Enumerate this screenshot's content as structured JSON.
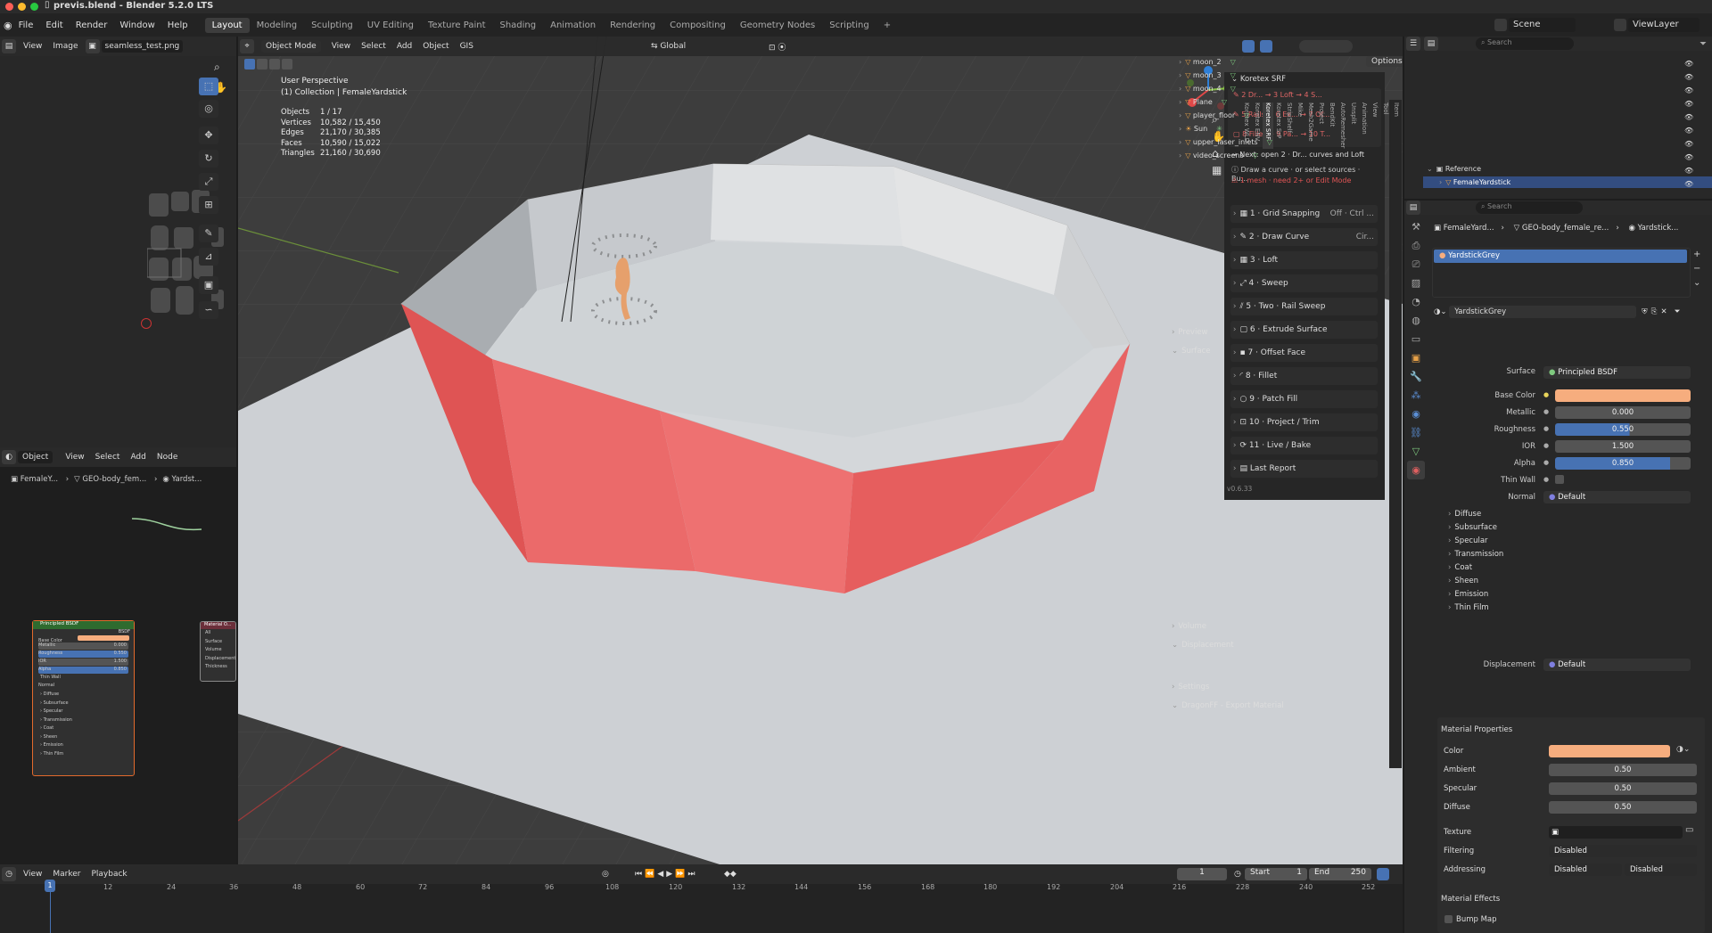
{
  "window": {
    "title": "previs.blend - Blender 5.2.0 LTS"
  },
  "menu": [
    "File",
    "Edit",
    "Render",
    "Window",
    "Help"
  ],
  "workspaces": [
    "Layout",
    "Modeling",
    "Sculpting",
    "UV Editing",
    "Texture Paint",
    "Shading",
    "Animation",
    "Rendering",
    "Compositing",
    "Geometry Nodes",
    "Scripting",
    "+"
  ],
  "scene": {
    "label": "Scene",
    "viewlayer": "ViewLayer"
  },
  "image_editor": {
    "view": "View",
    "image": "Image",
    "filename": "seamless_test.png"
  },
  "node_editor": {
    "mode": "Object",
    "view": "View",
    "select": "Select",
    "add": "Add",
    "node": "Node",
    "crumb1": "FemaleY...",
    "crumb2": "GEO-body_fem...",
    "crumb3": "Yardst...",
    "bsdf_title": "Principled BSDF",
    "bsdf_out": "BSDF",
    "base_color": "Base Color",
    "metallic": "Metallic",
    "metallic_v": "0.000",
    "roughness": "Roughness",
    "roughness_v": "0.550",
    "ior": "IOR",
    "ior_v": "1.500",
    "alpha": "Alpha",
    "alpha_v": "0.850",
    "thinwall": "Thin Wall",
    "normal": "Normal",
    "subs": [
      "Diffuse",
      "Subsurface",
      "Specular",
      "Transmission",
      "Coat",
      "Sheen",
      "Emission",
      "Thin Film"
    ],
    "out_title": "Material O...",
    "out_items": [
      "All",
      "Surface",
      "Volume",
      "Displacement",
      "Thickness"
    ]
  },
  "viewport": {
    "mode": "Object Mode",
    "view": "View",
    "select": "Select",
    "add": "Add",
    "object": "Object",
    "gis": "GIS",
    "orient": "Global",
    "options": "Options",
    "title": "User Perspective",
    "collection": "(1) Collection | FemaleYardstick",
    "stats": [
      [
        "Objects",
        "1 / 17"
      ],
      [
        "Vertices",
        "10,582 / 15,450"
      ],
      [
        "Edges",
        "21,170 / 30,385"
      ],
      [
        "Faces",
        "10,590 / 15,022"
      ],
      [
        "Triangles",
        "21,160 / 30,690"
      ]
    ]
  },
  "koretex": {
    "title": "Koretex SRF",
    "flow": [
      [
        "2 Dr...",
        "3 Loft",
        "4 S..."
      ],
      [
        "5 Rails",
        "6 Ex...",
        "7 Of..."
      ],
      [
        "8 Fillet",
        "9 Pa...",
        "10 T..."
      ]
    ],
    "next": "Next: open 2 · Dr... curves and Loft",
    "hint": "Draw a curve · or select sources · Bu...",
    "warn": "1 mesh · need 2+ or Edit Mode",
    "steps": [
      [
        "1 · Grid Snapping",
        "Off · Ctrl ..."
      ],
      [
        "2 · Draw Curve",
        "Cir..."
      ],
      [
        "3 · Loft",
        ""
      ],
      [
        "4 · Sweep",
        ""
      ],
      [
        "5 · Two · Rail Sweep",
        ""
      ],
      [
        "6 · Extrude Surface",
        ""
      ],
      [
        "7 · Offset Face",
        ""
      ],
      [
        "8 · Fillet",
        ""
      ],
      [
        "9 · Patch Fill",
        ""
      ],
      [
        "10 · Project / Trim",
        ""
      ],
      [
        "11 · Live / Bake",
        ""
      ],
      [
        "Last Report",
        ""
      ]
    ],
    "version": "v0.6.33"
  },
  "vtabs": [
    "Item",
    "Tool",
    "View",
    "Animation",
    "Unsplit",
    "AutoRemesher",
    "BendKit",
    "Project",
    "Mesh2Game",
    "Mike",
    "StripShelf",
    "Koretex SrP",
    "Koretex SRF",
    "Koretex ENV",
    "Koretex WLD"
  ],
  "outliner": {
    "search": "Search",
    "items": [
      "moon_2",
      "moon_3",
      "moon_4",
      "Plane",
      "player_floor",
      "Sun",
      "upper_laser_inlets",
      "video_screens"
    ],
    "reference": "Reference",
    "selected": "FemaleYardstick"
  },
  "properties": {
    "search": "Search",
    "crumb1": "FemaleYard...",
    "crumb2": "GEO-body_female_re...",
    "crumb3": "Yardstick...",
    "slot": "YardstickGrey",
    "material": "YardstickGrey",
    "preview": "Preview",
    "surface": "Surface",
    "surface_label": "Surface",
    "surface_val": "Principled BSDF",
    "base_color": "Base Color",
    "metallic": "Metallic",
    "metallic_v": "0.000",
    "roughness": "Roughness",
    "roughness_v": "0.550",
    "ior": "IOR",
    "ior_v": "1.500",
    "alpha": "Alpha",
    "alpha_v": "0.850",
    "thinwall": "Thin Wall",
    "normal": "Normal",
    "normal_v": "Default",
    "subs": [
      "Diffuse",
      "Subsurface",
      "Specular",
      "Transmission",
      "Coat",
      "Sheen",
      "Emission",
      "Thin Film"
    ],
    "volume": "Volume",
    "displacement": "Displacement",
    "disp_label": "Displacement",
    "disp_v": "Default",
    "settings": "Settings",
    "dragon": "DragonFF - Export Material",
    "matprops": "Material Properties",
    "color": "Color",
    "ambient": "Ambient",
    "ambient_v": "0.50",
    "specular": "Specular",
    "specular_v": "0.50",
    "diffuse": "Diffuse",
    "diffuse_v": "0.50",
    "texture": "Texture",
    "filtering": "Filtering",
    "filtering_v": "Disabled",
    "addressing": "Addressing",
    "addr_v1": "Disabled",
    "addr_v2": "Disabled",
    "effects": "Material Effects",
    "bump": "Bump Map"
  },
  "timeline": {
    "view": "View",
    "marker": "Marker",
    "playback": "Playback",
    "frame": "1",
    "start_l": "Start",
    "start": "1",
    "end_l": "End",
    "end": "250",
    "ticks": [
      "1",
      "12",
      "24",
      "36",
      "48",
      "60",
      "72",
      "84",
      "96",
      "108",
      "120",
      "132",
      "144",
      "156",
      "168",
      "180",
      "192",
      "204",
      "216",
      "228",
      "240",
      "252"
    ]
  },
  "colors": {
    "accent": "#4772b3",
    "base": "#f6ad7e",
    "wall": "#e96565",
    "selected_row": "#334d80"
  }
}
